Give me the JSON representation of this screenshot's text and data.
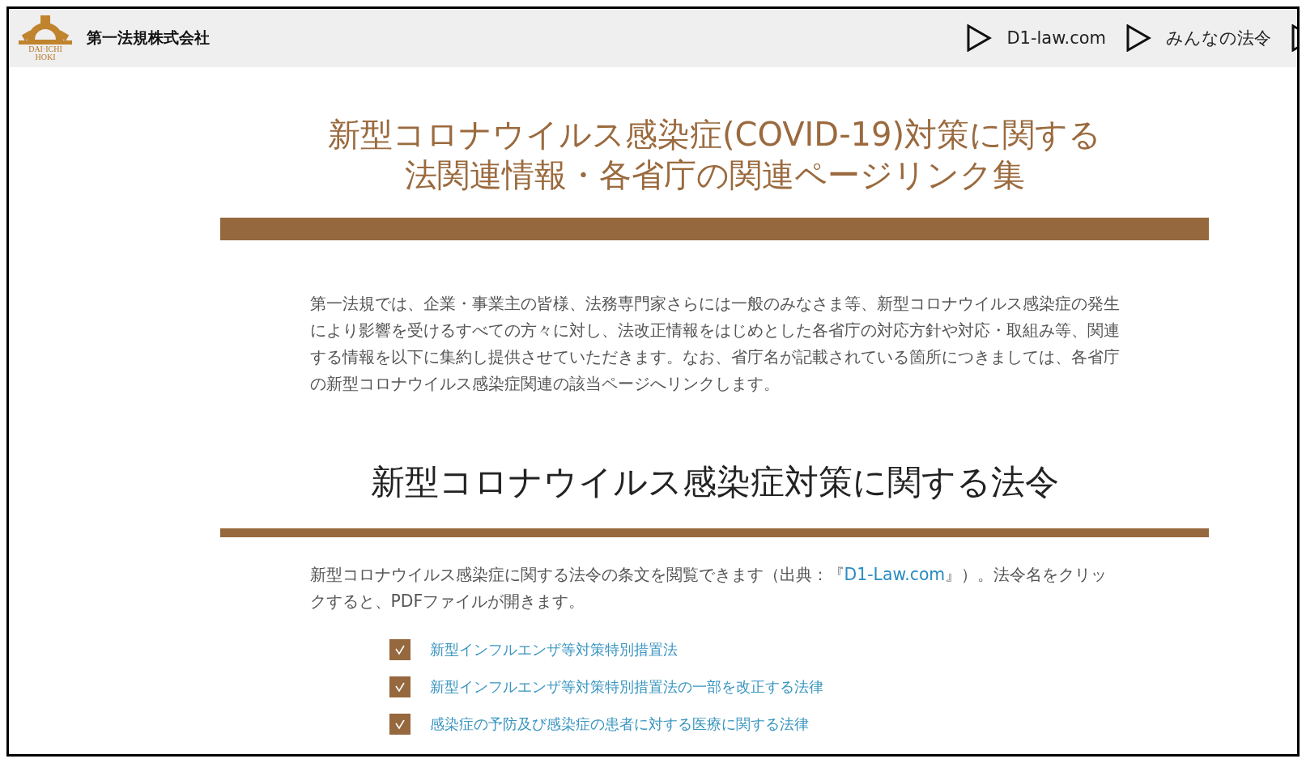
{
  "header": {
    "company": "第一法規株式会社",
    "logo_text": [
      "DAI·ICHI",
      "HOKI"
    ],
    "nav": [
      {
        "kind": "link",
        "label": "D1-law.com"
      },
      {
        "kind": "link",
        "label": "みんなの法令"
      },
      {
        "kind": "icon"
      }
    ]
  },
  "title": [
    "新型コロナウイルス感染症(COVID-19)対策に関する",
    "法関連情報・各省庁の関連ページリンク集"
  ],
  "intro": "第一法規では、企業・事業主の皆様、法務専門家さらには一般のみなさま等、新型コロナウイルス感染症の発生により影響を受けるすべての方々に対し、法改正情報をはじめとした各省庁の対応方針や対応・取組み等、関連する情報を以下に集約し提供させていただきます。なお、省庁名が記載されている箇所につきましては、各省庁の新型コロナウイルス感染症関連の該当ページへリンクします。",
  "section": {
    "heading": "新型コロナウイルス感染症対策に関する法令",
    "text_before": "新型コロナウイルス感染症に関する法令の条文を閲覧できます（出典：『",
    "link": "D1-Law.com",
    "text_after": "』）。法令名をクリックすると、PDFファイルが開きます。",
    "laws": [
      {
        "label": "新型インフルエンザ等対策特別措置法"
      },
      {
        "label": "新型インフルエンザ等対策特別措置法の一部を改正する法律"
      },
      {
        "label": "感染症の予防及び感染症の患者に対する医療に関する法律"
      }
    ]
  }
}
